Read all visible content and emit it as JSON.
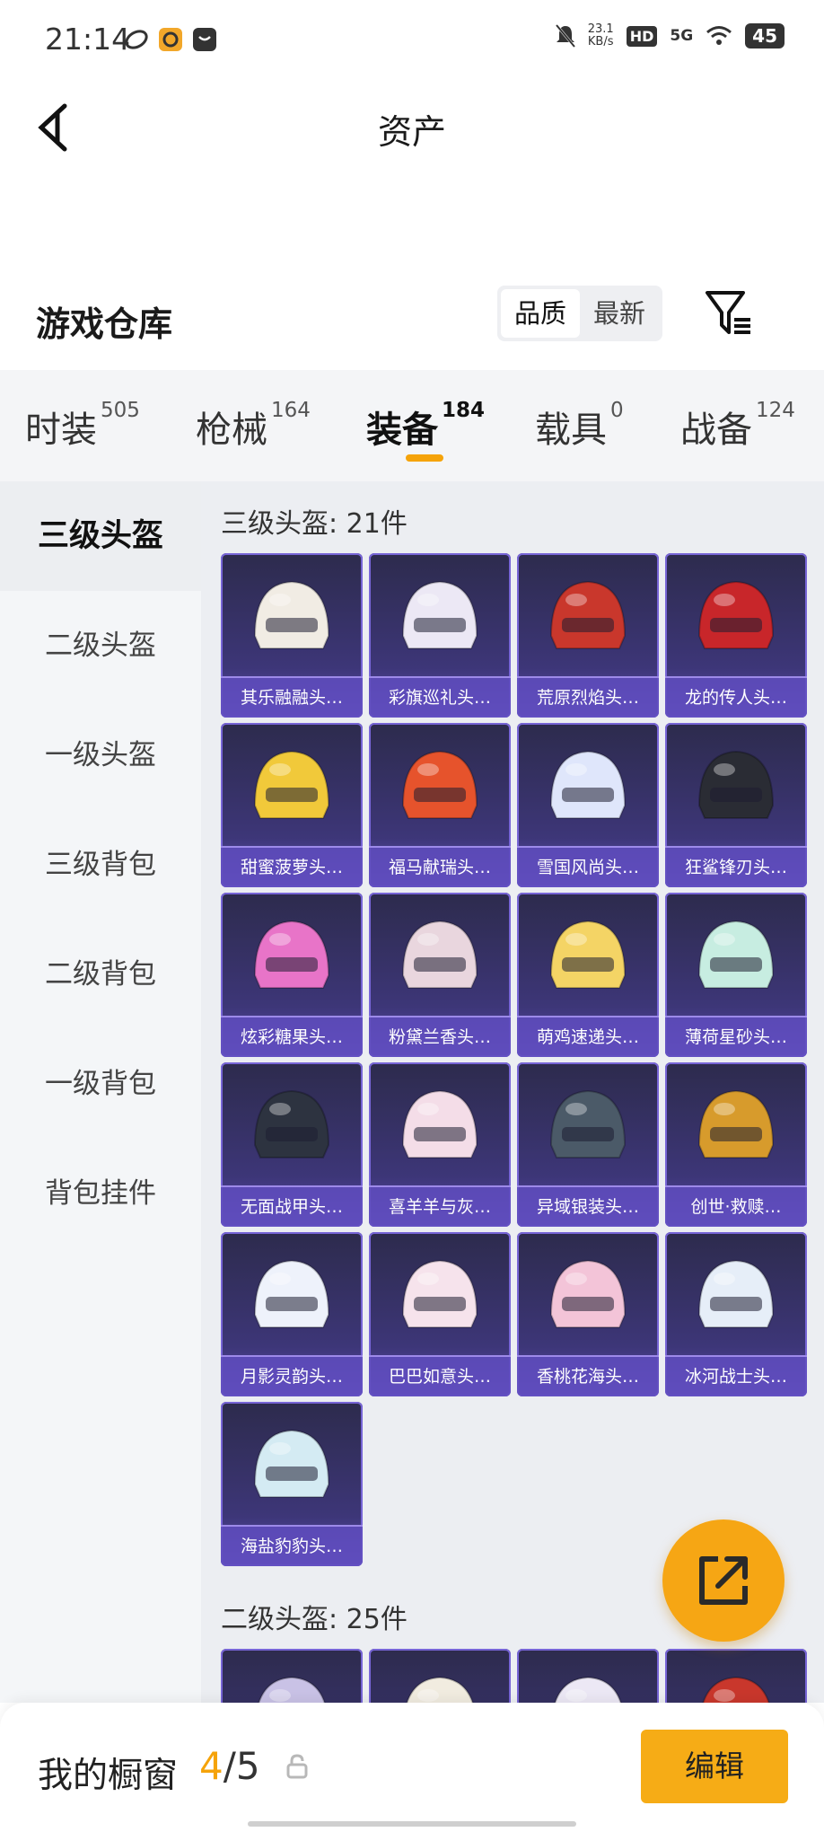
{
  "status_bar": {
    "time": "21:14",
    "speed_value": "23.1",
    "speed_unit": "KB/s",
    "hd": "HD",
    "network": "5G",
    "battery": "45"
  },
  "header": {
    "title": "资产"
  },
  "warehouse": {
    "title": "游戏仓库",
    "sort_quality": "品质",
    "sort_latest": "最新"
  },
  "category_tabs": [
    {
      "label": "时装",
      "count": "505"
    },
    {
      "label": "枪械",
      "count": "164"
    },
    {
      "label": "装备",
      "count": "184"
    },
    {
      "label": "载具",
      "count": "0"
    },
    {
      "label": "战备",
      "count": "124"
    }
  ],
  "active_category": "装备",
  "sidebar": [
    {
      "label": "三级头盔"
    },
    {
      "label": "二级头盔"
    },
    {
      "label": "一级头盔"
    },
    {
      "label": "三级背包"
    },
    {
      "label": "二级背包"
    },
    {
      "label": "一级背包"
    },
    {
      "label": "背包挂件"
    }
  ],
  "sections": [
    {
      "heading": "三级头盔: 21件",
      "items": [
        {
          "name": "其乐融融头…",
          "color": "#f1ece4"
        },
        {
          "name": "彩旗巡礼头…",
          "color": "#ece8f5"
        },
        {
          "name": "荒原烈焰头…",
          "color": "#c9372c"
        },
        {
          "name": "龙的传人头…",
          "color": "#c8262a"
        },
        {
          "name": "甜蜜菠萝头…",
          "color": "#f1c93a"
        },
        {
          "name": "福马献瑞头…",
          "color": "#e6532c"
        },
        {
          "name": "雪国风尚头…",
          "color": "#dfe6fb"
        },
        {
          "name": "狂鲨锋刃头…",
          "color": "#2a2c34"
        },
        {
          "name": "炫彩糖果头…",
          "color": "#e874c8"
        },
        {
          "name": "粉黛兰香头…",
          "color": "#e9d6de"
        },
        {
          "name": "萌鸡速递头…",
          "color": "#f4d465"
        },
        {
          "name": "薄荷星砂头…",
          "color": "#c7ede1"
        },
        {
          "name": "无面战甲头…",
          "color": "#2d3340"
        },
        {
          "name": "喜羊羊与灰…",
          "color": "#f4dde8"
        },
        {
          "name": "异域银装头…",
          "color": "#4b5a68"
        },
        {
          "name": "创世·救赎…",
          "color": "#d79b2c"
        },
        {
          "name": "月影灵韵头…",
          "color": "#eef2fb"
        },
        {
          "name": "巴巴如意头…",
          "color": "#f6e3ec"
        },
        {
          "name": "香桃花海头…",
          "color": "#f3c4d8"
        },
        {
          "name": "冰河战士头…",
          "color": "#e6eef8"
        },
        {
          "name": "海盐豹豹头…",
          "color": "#d4ebf3"
        }
      ]
    },
    {
      "heading": "二级头盔: 25件",
      "items": [
        {
          "name": "",
          "color": "#c9c2e6"
        },
        {
          "name": "",
          "color": "#f1ece0"
        },
        {
          "name": "",
          "color": "#ece8f5"
        },
        {
          "name": "",
          "color": "#c9372c"
        }
      ]
    }
  ],
  "showcase": {
    "title": "我的橱窗",
    "current": "4",
    "separator": "/",
    "total": "5",
    "edit_label": "编辑"
  },
  "icons": {
    "back": "chevron-left-icon",
    "filter": "filter-icon",
    "share": "share-icon",
    "lock": "lock-icon"
  },
  "colors": {
    "accent": "#f5a30a",
    "card_top": "#2d2b4d",
    "card_bottom": "#5f4fb6"
  }
}
